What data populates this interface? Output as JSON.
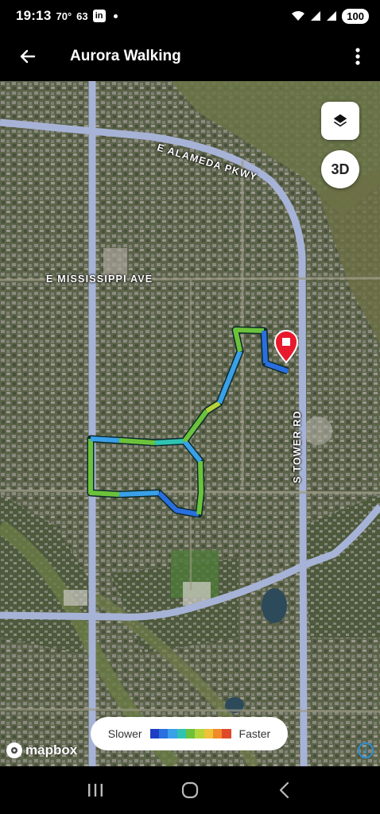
{
  "status_bar": {
    "time": "19:13",
    "temperature": "70°",
    "aqi": "63",
    "linkedin": "in",
    "battery": "100"
  },
  "app_bar": {
    "title": "Aurora Walking",
    "back_icon": "arrow-left-icon",
    "menu_icon": "more-vert-icon"
  },
  "map": {
    "roads": {
      "alameda": "E ALAMEDA PKWY",
      "mississippi": "E MISSISSIPPI AVE",
      "tower": "S TOWER RD"
    },
    "controls": {
      "layers_icon": "layers-icon",
      "three_d_label": "3D"
    },
    "legend": {
      "slower_label": "Slower",
      "faster_label": "Faster",
      "colors": [
        "#1d3fc4",
        "#2a6fe0",
        "#3aa0e8",
        "#2fc3b3",
        "#6cc23a",
        "#b6d43a",
        "#f0c23a",
        "#f08a2a",
        "#e04a2a"
      ]
    },
    "attribution": "mapbox",
    "route_colors": {
      "slow": "#2a6fe0",
      "mid": "#3aa0e8",
      "fast": "#6cc23a"
    },
    "end_marker_color": "#e8192c"
  },
  "nav_bar": {
    "recents_icon": "recents-icon",
    "home_icon": "home-icon",
    "back_icon": "back-icon"
  }
}
